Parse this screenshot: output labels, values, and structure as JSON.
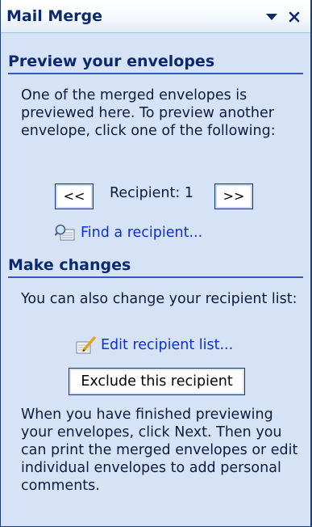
{
  "pane": {
    "title": "Mail Merge",
    "menu_icon": "dropdown-arrow-icon",
    "close_icon": "close-icon"
  },
  "preview": {
    "heading": "Preview your envelopes",
    "description": "One of the merged envelopes is previewed here. To preview another envelope, click one of the following:",
    "prev_label": "<<",
    "next_label": ">>",
    "recipient_label": "Recipient: 1",
    "find_link": "Find a recipient...",
    "find_icon": "find-recipient-icon"
  },
  "changes": {
    "heading": "Make changes",
    "description": "You can also change your recipient list:",
    "edit_link": "Edit recipient list...",
    "edit_icon": "edit-list-icon",
    "exclude_label": "Exclude this recipient",
    "footer_text": "When you have finished previewing your envelopes, click Next. Then you can print the merged envelopes or edit individual envelopes to add personal comments."
  },
  "colors": {
    "pane_background": "#d6e3f7",
    "heading_text": "#0c2a6b",
    "link_text": "#0b2fdc",
    "rule": "#2d5cb0"
  }
}
